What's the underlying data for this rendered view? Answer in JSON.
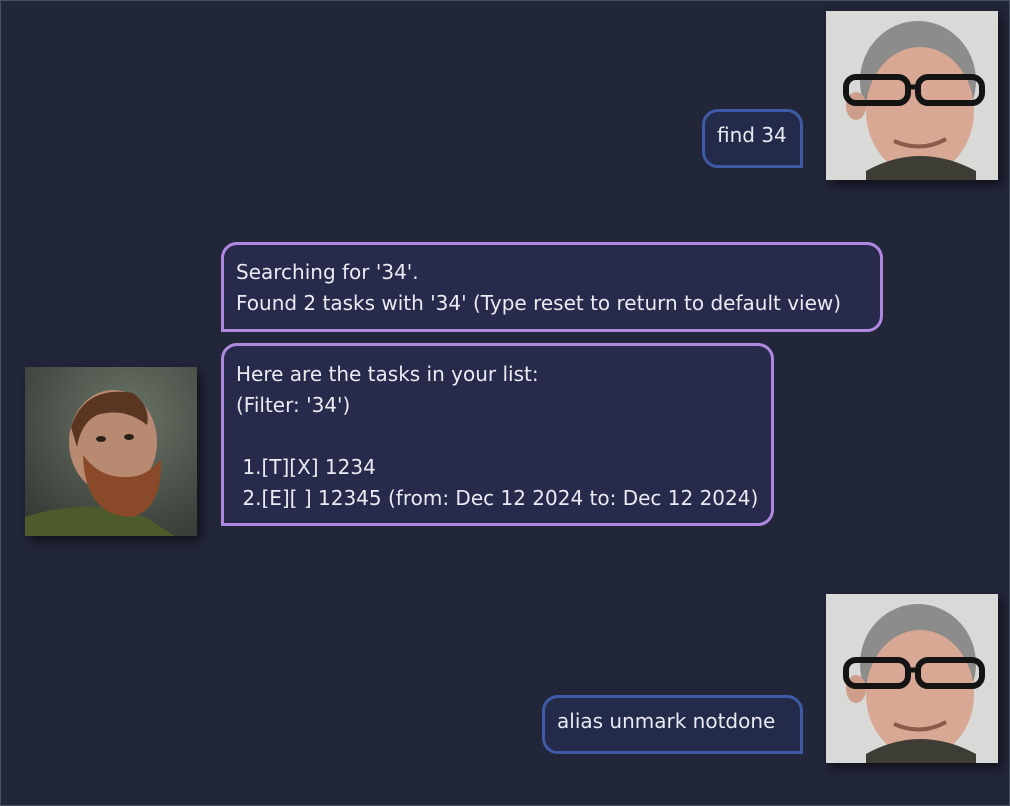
{
  "conversation": {
    "user_message_1": "find 34",
    "bot_message_1": "Searching for '34'.\nFound 2 tasks with '34' (Type reset to return to default view)",
    "bot_message_2": "Here are the tasks in your list:\n(Filter: '34')\n\n 1.[T][X] 1234\n 2.[E][ ] 12345 (from: Dec 12 2024 to: Dec 12 2024)",
    "user_message_2": "alias unmark notdone"
  },
  "colors": {
    "background": "#222639",
    "user_bubble_border": "#3f5aa6",
    "bot_bubble_border": "#b088e0",
    "text": "#e9eaf2"
  }
}
